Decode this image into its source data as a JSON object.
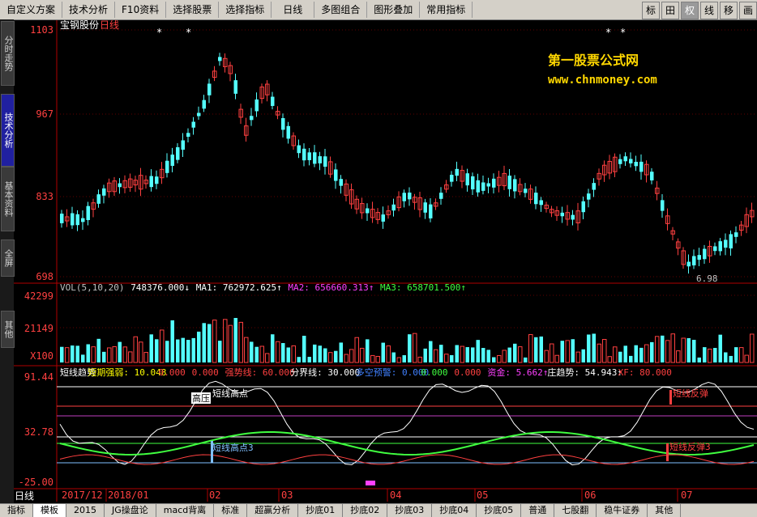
{
  "menu": [
    "自定义方案",
    "技术分析",
    "F10资料",
    "选择股票",
    "选择指标",
    "日线",
    "多图组合",
    "图形叠加",
    "常用指标"
  ],
  "menu_right": [
    "标",
    "田",
    "权",
    "线",
    "移",
    "画"
  ],
  "sidebar": [
    "分时走势",
    "技术分析",
    "基本资料",
    "全屏",
    "其他"
  ],
  "stock_title": "宝钢股份",
  "period": "日线",
  "watermark": {
    "line1": "第一股票公式网",
    "line2": "www.chnmoney.com"
  },
  "price_axis": [
    "1103",
    "967",
    "833",
    "698"
  ],
  "price_annotation": "6.98",
  "vol_axis": [
    "42299",
    "21149",
    "X100"
  ],
  "vol_legend": [
    {
      "text": "VOL(5,10,20)",
      "color": "#c0c0c0"
    },
    {
      "text": "748376.000↓",
      "color": "#ffffff"
    },
    {
      "text": "MA1: 762972.625↑",
      "color": "#ffffff"
    },
    {
      "text": "MA2: 656660.313↑",
      "color": "#ff40ff"
    },
    {
      "text": "MA3: 658701.500↑",
      "color": "#40ff40"
    }
  ],
  "ind_axis": [
    "91.44",
    "32.78",
    "-25.00"
  ],
  "ind_legend": [
    {
      "text": "短线趋势",
      "color": "#ffffff"
    },
    {
      "text": "短期强弱: 10.048",
      "color": "#ffff00"
    },
    {
      "text": "0.000",
      "color": "#ff4040"
    },
    {
      "text": "0.000",
      "color": "#ff4040"
    },
    {
      "text": "强势线: 60.000",
      "color": "#ff4040"
    },
    {
      "text": "分界线: 30.000",
      "color": "#ffffff"
    },
    {
      "text": "多空预警: 0.000",
      "color": "#4080ff"
    },
    {
      "text": "0.000",
      "color": "#40ff40"
    },
    {
      "text": "0.000",
      "color": "#ff4040"
    },
    {
      "text": "资金: 5.662↑",
      "color": "#ff40ff"
    },
    {
      "text": "庄趋势: 54.943↑",
      "color": "#ffffff"
    },
    {
      "text": "XF: 80.000",
      "color": "#ff4040"
    }
  ],
  "ind_labels": {
    "high_pressure": "高压",
    "short_high": "短线高点",
    "short_high3": "短线高点3",
    "rebound": "短线反弹",
    "rebound3": "短线反弹3"
  },
  "date_axis": [
    "2017/12",
    "2018/01",
    "02",
    "03",
    "04",
    "05",
    "06",
    "07"
  ],
  "period_bottom": "日线",
  "bottom_tabs": [
    "指标",
    "模板",
    "2015",
    "JG操盘论",
    "macd背离",
    "标准",
    "超赢分析",
    "抄底01",
    "抄底02",
    "抄底03",
    "抄底04",
    "抄底05",
    "普通",
    "七股翻",
    "稳牛证券",
    "其他"
  ]
}
